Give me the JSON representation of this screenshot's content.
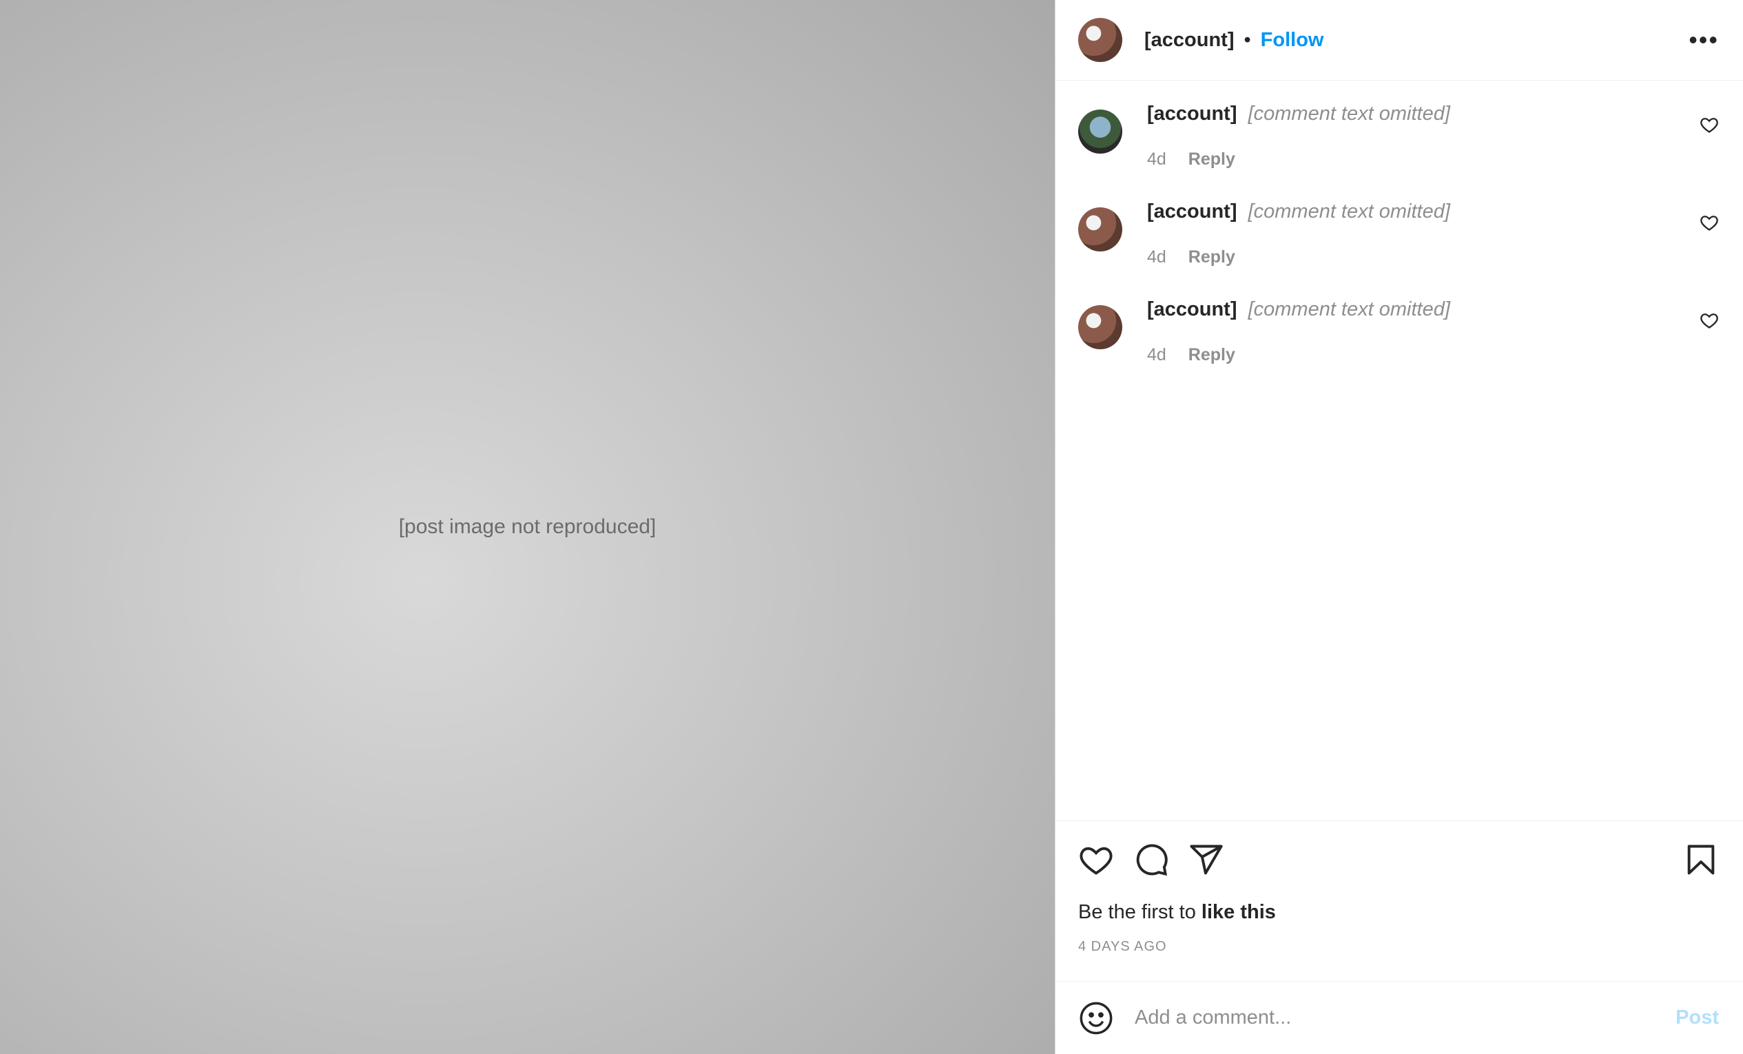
{
  "media": {
    "note": "[post image not reproduced]"
  },
  "header": {
    "username": "[account]",
    "separator": "•",
    "follow_label": "Follow",
    "more_label": "•••"
  },
  "comments": [
    {
      "username": "[account]",
      "text": "[comment text omitted]",
      "age": "4d",
      "reply_label": "Reply"
    },
    {
      "username": "[account]",
      "text": "[comment text omitted]",
      "age": "4d",
      "reply_label": "Reply"
    },
    {
      "username": "[account]",
      "text": "[comment text omitted]",
      "age": "4d",
      "reply_label": "Reply"
    }
  ],
  "actions": {
    "likes_prefix": "Be the first to ",
    "likes_strong": "like this",
    "date": "4 DAYS AGO"
  },
  "composer": {
    "placeholder": "Add a comment...",
    "post_label": "Post"
  },
  "colors": {
    "accent": "#0095f6",
    "post_disabled": "#b2dffc",
    "muted": "#8e8e8e"
  },
  "icons": [
    "heart-icon",
    "comment-icon",
    "share-icon",
    "bookmark-icon",
    "emoji-icon",
    "more-icon"
  ]
}
